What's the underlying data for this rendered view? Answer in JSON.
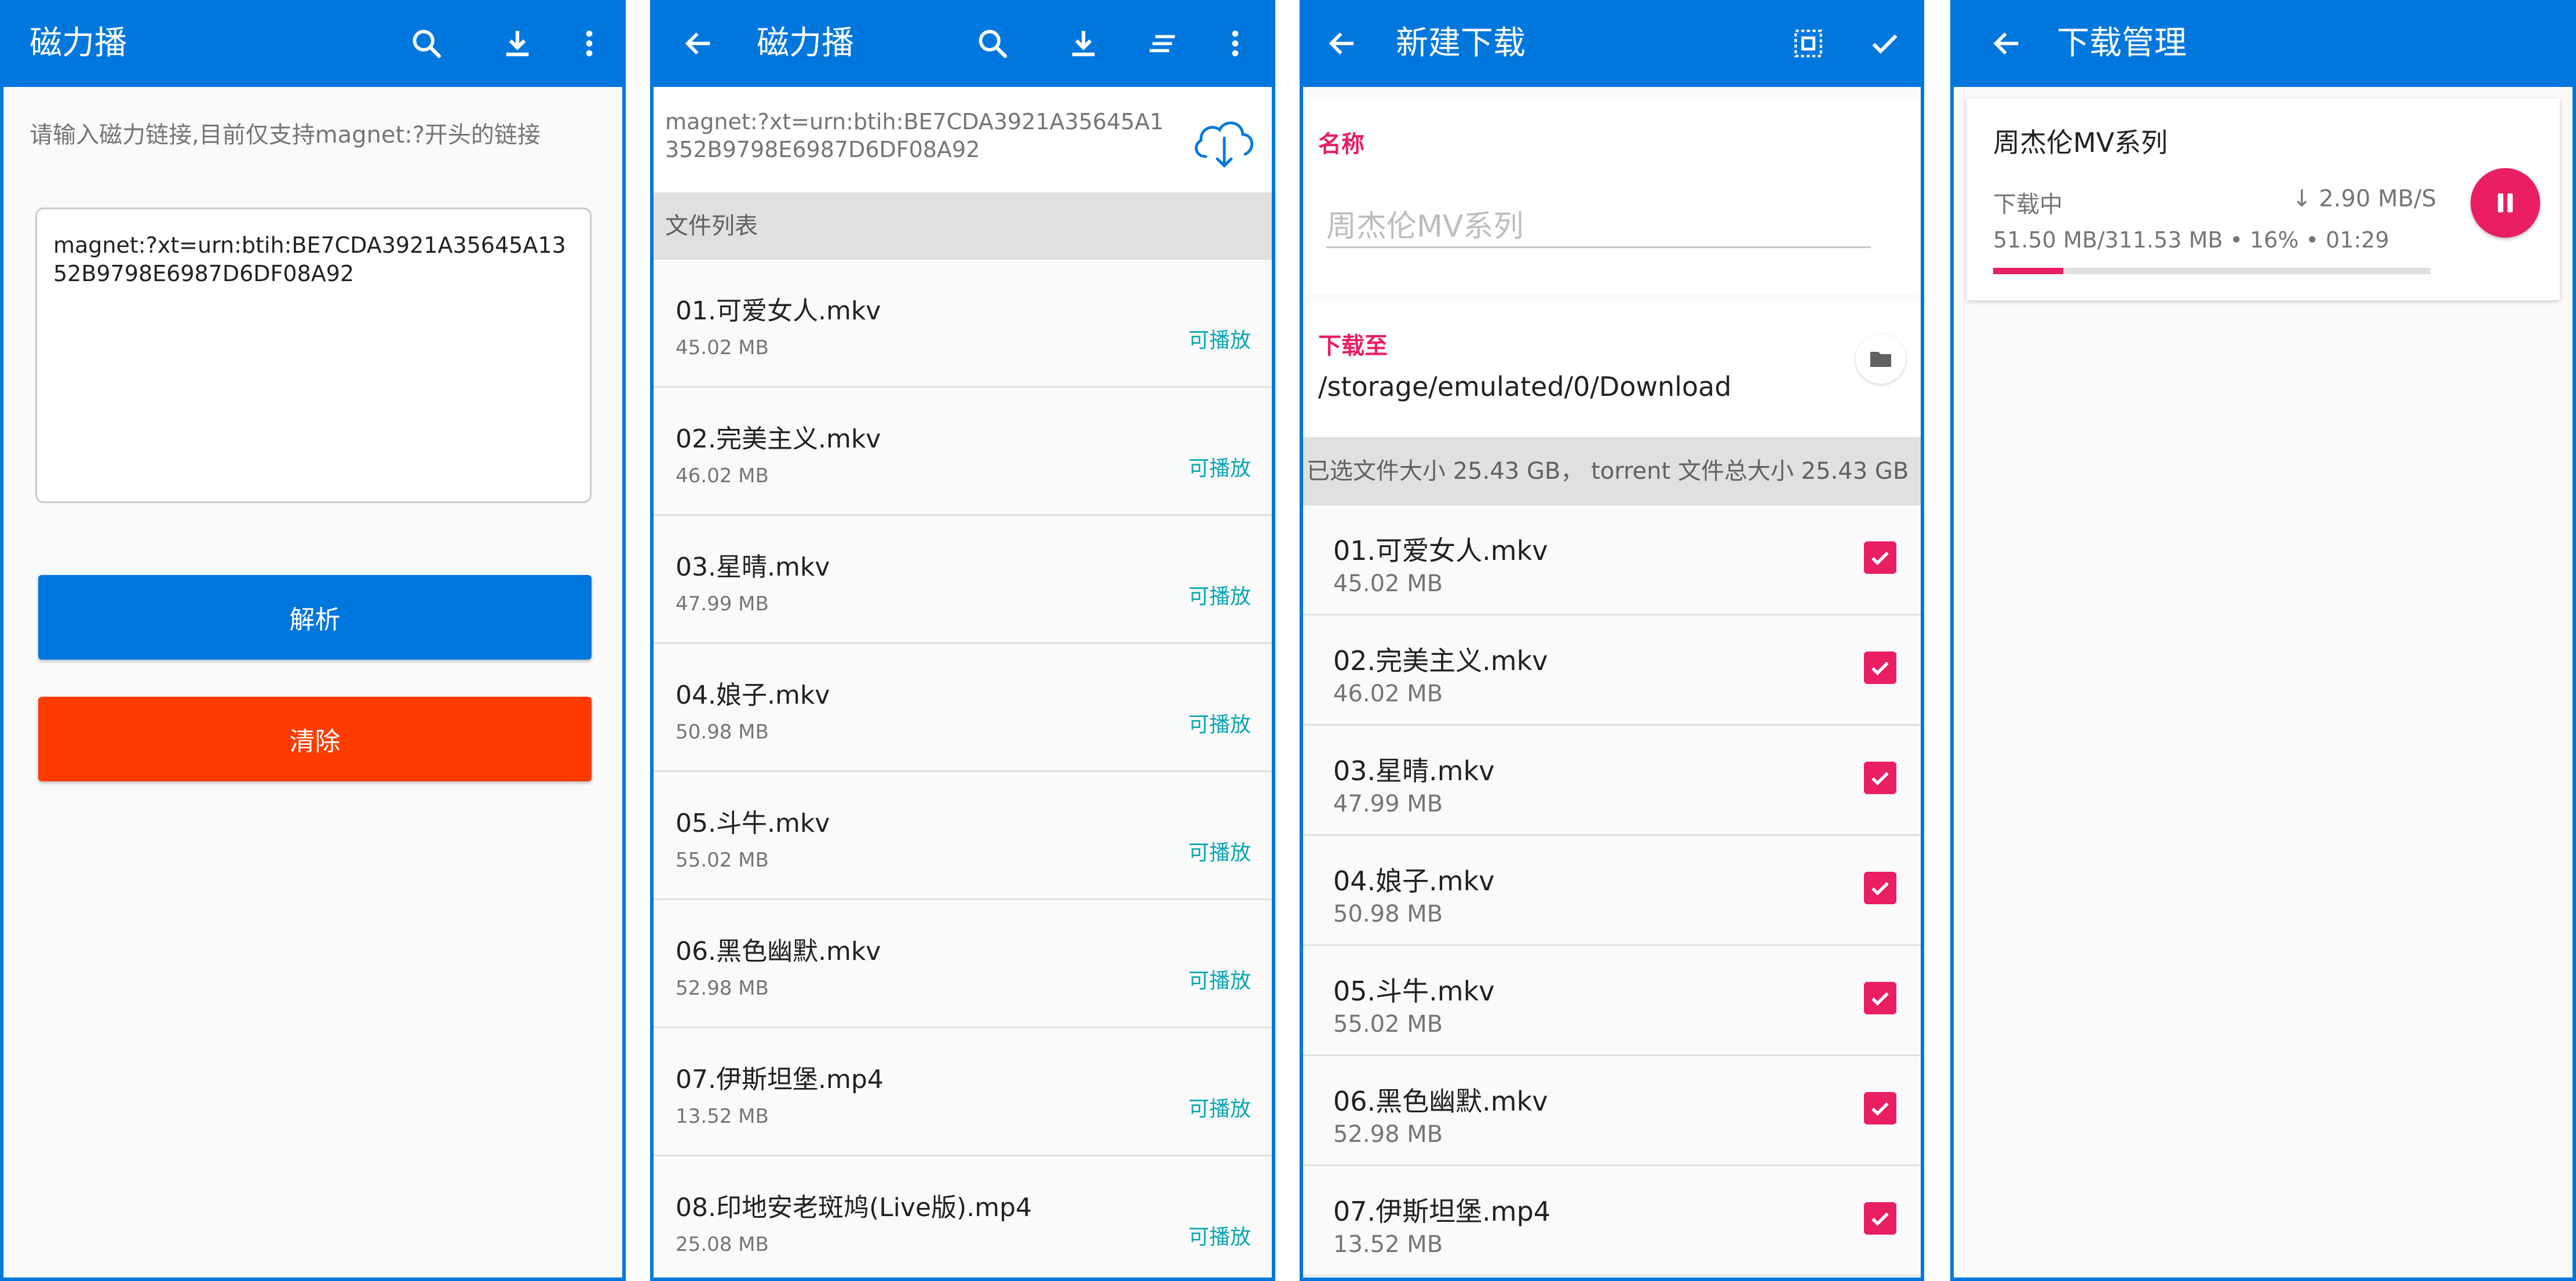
{
  "screen1": {
    "title": "磁力播",
    "hint": "请输入磁力链接,目前仅支持magnet:?开头的链接",
    "magnet_value": "magnet:?xt=urn:btih:BE7CDA3921A35645A1352B9798E6987D6DF08A92",
    "parse_label": "解析",
    "clear_label": "清除"
  },
  "screen2": {
    "title": "磁力播",
    "magnet": "magnet:?xt=urn:btih:BE7CDA3921A35645A1352B9798E6987D6DF08A92",
    "list_header": "文件列表",
    "files": [
      {
        "name": "01.可爱女人.mkv",
        "size": "45.02 MB",
        "status": "可播放"
      },
      {
        "name": "02.完美主义.mkv",
        "size": "46.02 MB",
        "status": "可播放"
      },
      {
        "name": "03.星晴.mkv",
        "size": "47.99 MB",
        "status": "可播放"
      },
      {
        "name": "04.娘子.mkv",
        "size": "50.98 MB",
        "status": "可播放"
      },
      {
        "name": "05.斗牛.mkv",
        "size": "55.02 MB",
        "status": "可播放"
      },
      {
        "name": "06.黑色幽默.mkv",
        "size": "52.98 MB",
        "status": "可播放"
      },
      {
        "name": "07.伊斯坦堡.mp4",
        "size": "13.52 MB",
        "status": "可播放"
      },
      {
        "name": "08.印地安老斑鸠(Live版).mp4",
        "size": "25.08 MB",
        "status": "可播放"
      }
    ]
  },
  "screen3": {
    "title": "新建下载",
    "name_label": "名称",
    "name_placeholder": "周杰伦MV系列",
    "save_label": "下载至",
    "save_path": "/storage/emulated/0/Download",
    "size_summary": "已选文件大小 25.43 GB， torrent 文件总大小 25.43 GB",
    "files": [
      {
        "name": "01.可爱女人.mkv",
        "size": "45.02 MB"
      },
      {
        "name": "02.完美主义.mkv",
        "size": "46.02 MB"
      },
      {
        "name": "03.星晴.mkv",
        "size": "47.99 MB"
      },
      {
        "name": "04.娘子.mkv",
        "size": "50.98 MB"
      },
      {
        "name": "05.斗牛.mkv",
        "size": "55.02 MB"
      },
      {
        "name": "06.黑色幽默.mkv",
        "size": "52.98 MB"
      },
      {
        "name": "07.伊斯坦堡.mp4",
        "size": "13.52 MB"
      }
    ]
  },
  "screen4": {
    "title": "下载管理",
    "task": {
      "name": "周杰伦MV系列",
      "status": "下载中",
      "speed": "↓ 2.90 MB/S",
      "info": "51.50 MB/311.53 MB • 16% • 01:29",
      "progress_percent": 16
    }
  },
  "colors": {
    "primary": "#0077dd",
    "accent": "#e91e63",
    "danger": "#ff3b00",
    "playable": "#0aa6b6"
  }
}
